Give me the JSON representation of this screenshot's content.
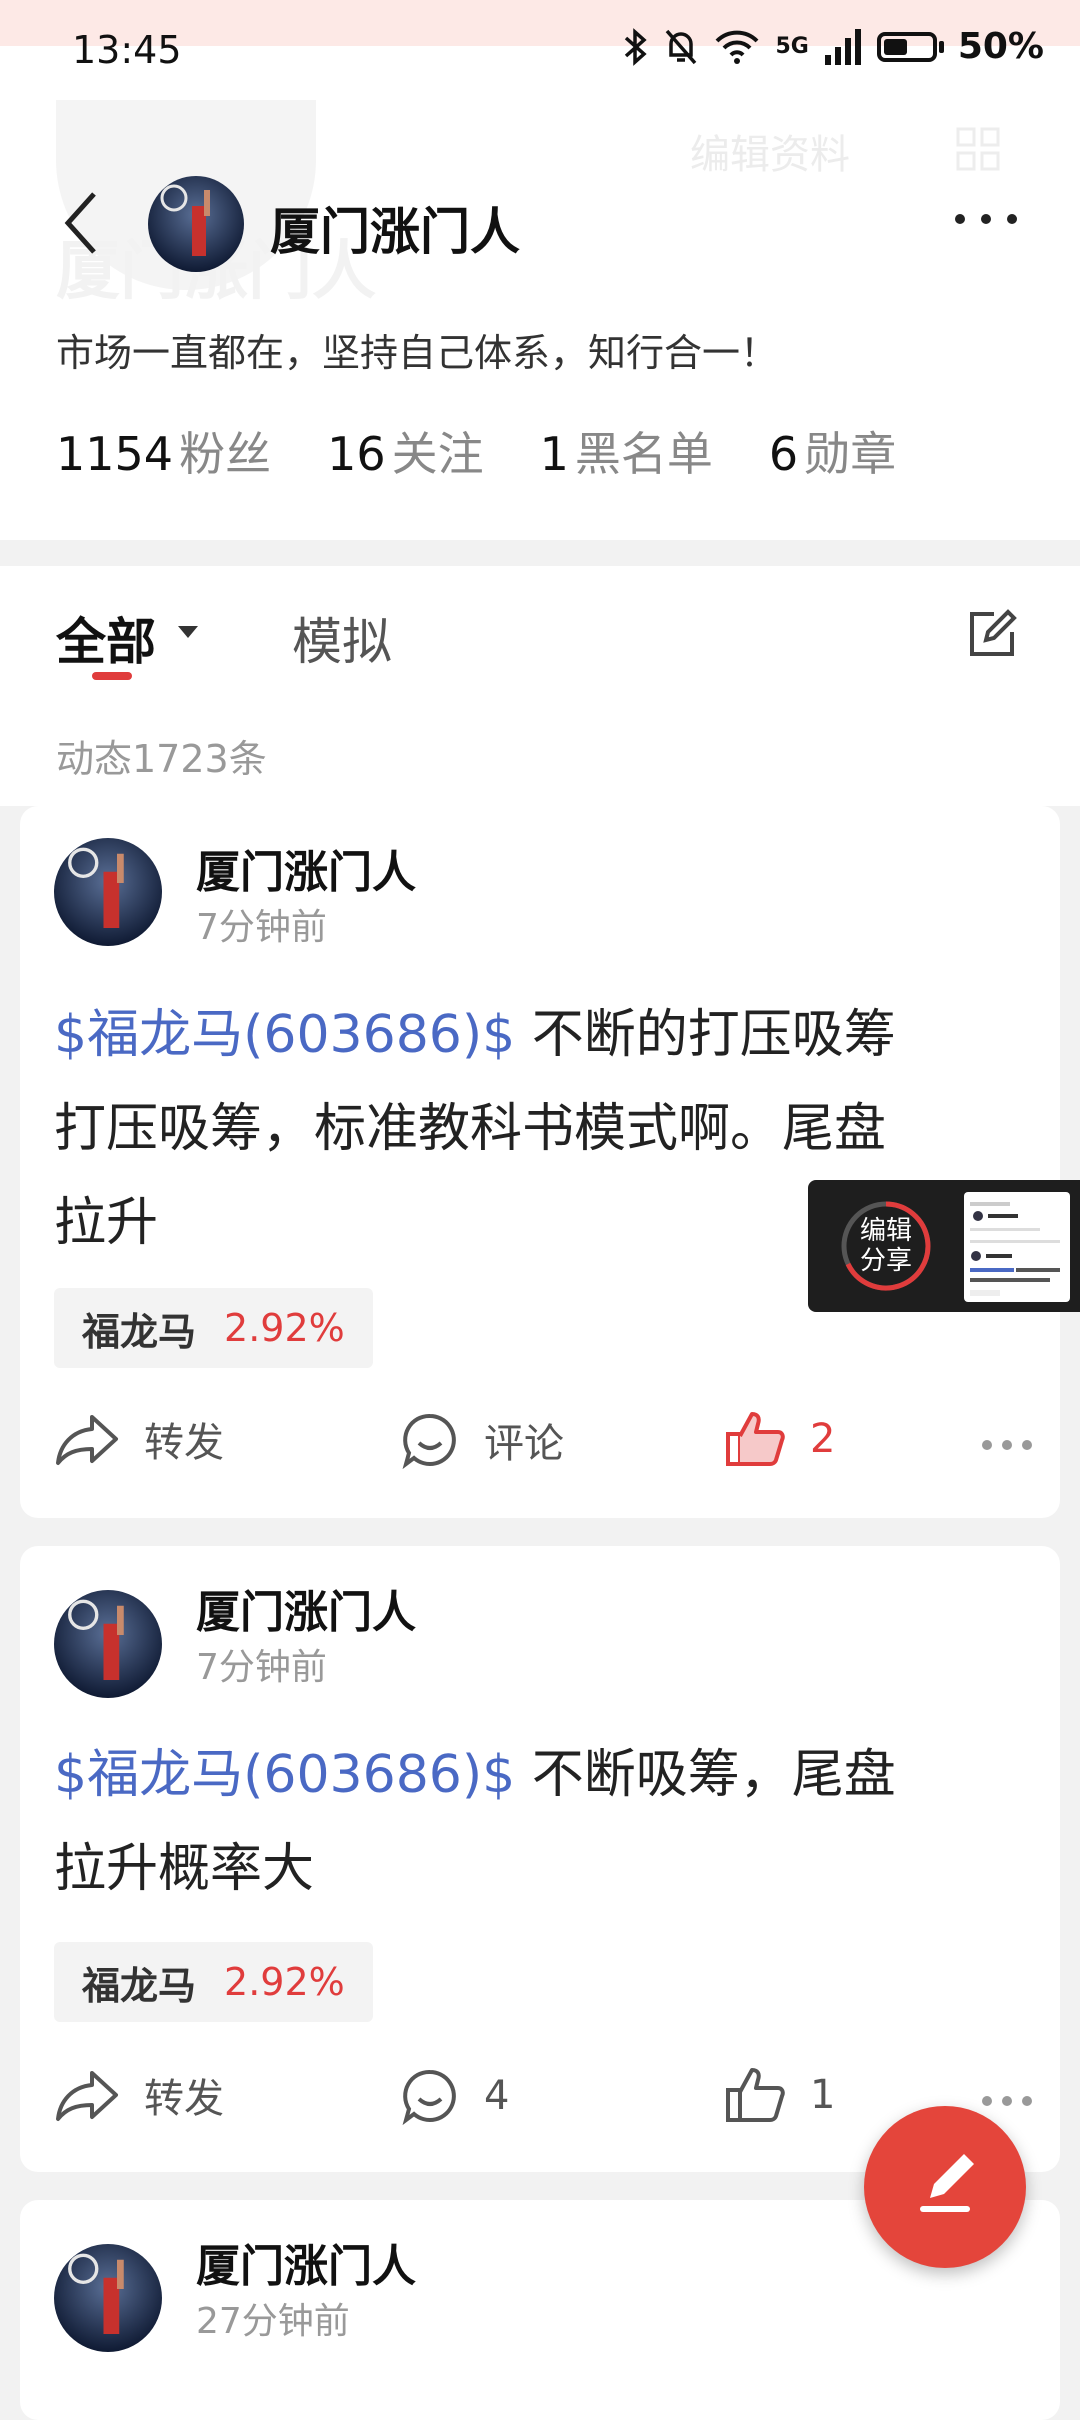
{
  "status_bar": {
    "time": "13:45",
    "network": "5G",
    "battery": "50%"
  },
  "header": {
    "ghost_edit_label": "编辑资料",
    "ghost_name": "厦门涨门人",
    "title": "厦门涨门人",
    "bio": "市场一直都在，坚持自己体系，知行合一！",
    "stats": [
      {
        "num": "1154",
        "label": "粉丝"
      },
      {
        "num": "16",
        "label": "关注"
      },
      {
        "num": "1",
        "label": "黑名单"
      },
      {
        "num": "6",
        "label": "勋章"
      }
    ]
  },
  "tabs": {
    "all": "全部",
    "sim": "模拟",
    "count": "动态1723条"
  },
  "posts": [
    {
      "user": "厦门涨门人",
      "time": "7分钟前",
      "stock_link": "$福龙马(603686)$",
      "text_line1": " 不断的打压吸筹",
      "text_line2": "打压吸筹，标准教科书模式啊。尾盘",
      "text_line3": "拉升",
      "tag_name": "福龙马",
      "tag_pct": "2.92%",
      "repost": "转发",
      "comment": "评论",
      "likes": "2"
    },
    {
      "user": "厦门涨门人",
      "time": "7分钟前",
      "stock_link": "$福龙马(603686)$",
      "text_line1": " 不断吸筹，尾盘",
      "text_line2": "拉升概率大",
      "tag_name": "福龙马",
      "tag_pct": "2.92%",
      "repost": "转发",
      "comment": "4",
      "likes": "1"
    },
    {
      "user": "厦门涨门人",
      "time": "27分钟前"
    }
  ],
  "share_popup": {
    "line1": "编辑",
    "line2": "分享"
  },
  "colors": {
    "accent_red": "#e03c3c",
    "link_blue": "#4a69c4",
    "fab_red": "#e4453b"
  }
}
